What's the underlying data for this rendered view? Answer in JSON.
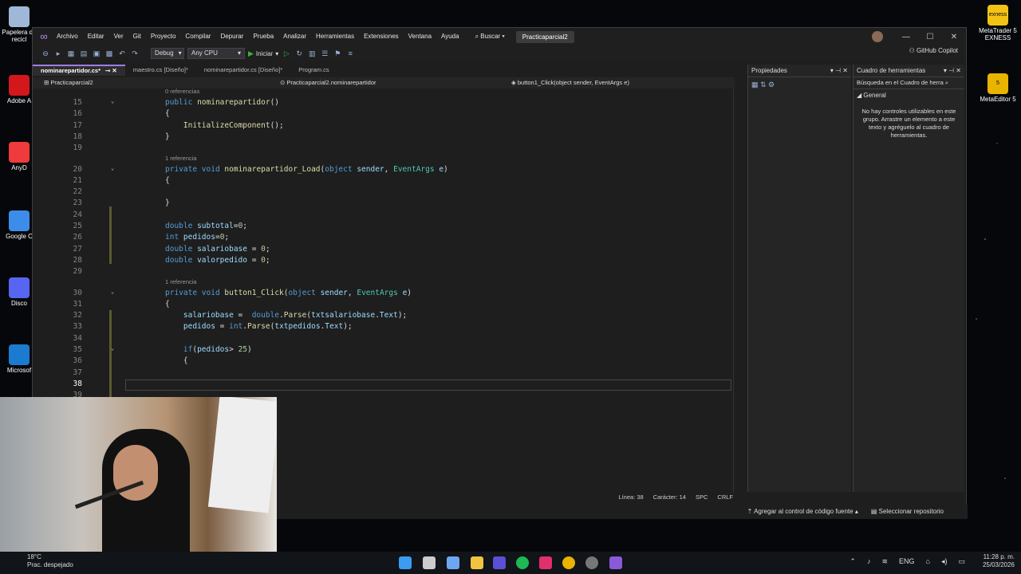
{
  "desktop_icons": [
    {
      "label": "Papelera de\nrecicl",
      "color": "#9fb8d8"
    },
    {
      "label": "Adobe A",
      "color": "#d4171d"
    },
    {
      "label": "AnyD",
      "color": "#ef3b3b"
    },
    {
      "label": "Google C",
      "color": "#3c8de9"
    },
    {
      "label": "Disco",
      "color": "#5865f2"
    },
    {
      "label": "Microsof",
      "color": "#1b7bd1"
    }
  ],
  "right_desktop_icons": [
    {
      "label": "MetaTrader 5\nEXNESS",
      "color": "#f2c315",
      "glyph": "exness"
    },
    {
      "label": "MetaEditor 5",
      "color": "#e9b400",
      "glyph": "5"
    }
  ],
  "menu": [
    "Archivo",
    "Editar",
    "Ver",
    "Git",
    "Proyecto",
    "Compilar",
    "Depurar",
    "Prueba",
    "Analizar",
    "Herramientas",
    "Extensiones",
    "Ventana",
    "Ayuda"
  ],
  "search_label": "Buscar",
  "project_name": "Practicaparcial2",
  "toolbar": {
    "config": "Debug",
    "platform": "Any CPU",
    "run": "Iniciar",
    "copilot": "GitHub Copilot"
  },
  "tabs": [
    {
      "label": "nominarepartidor.cs*",
      "active": true
    },
    {
      "label": "maestro.cs [Diseño]*"
    },
    {
      "label": "nominarepartidor.cs [Diseño]*"
    },
    {
      "label": "Program.cs"
    }
  ],
  "navbar": {
    "project": "Practicaparcial2",
    "class": "Practicaparcial2.nominarepartidor",
    "member": "button1_Click(object sender, EventArgs e)"
  },
  "code_lines": [
    {
      "n": 15,
      "lens": "0 referencias",
      "html": "<span class=\"kw\">public</span> <span class=\"fn\">nominarepartidor</span>()"
    },
    {
      "n": 16,
      "html": "{"
    },
    {
      "n": 17,
      "html": "    <span class=\"fn\">InitializeComponent</span>();"
    },
    {
      "n": 18,
      "html": "}"
    },
    {
      "n": 19,
      "html": ""
    },
    {
      "n": 20,
      "lens": "1 referencia",
      "html": "<span class=\"kw\">private</span> <span class=\"kw\">void</span> <span class=\"fn\">nominarepartidor_Load</span>(<span class=\"kw\">object</span> <span class=\"id\">sender</span>, <span class=\"ty\">EventArgs</span> <span class=\"id\">e</span>)"
    },
    {
      "n": 21,
      "html": "{"
    },
    {
      "n": 22,
      "html": ""
    },
    {
      "n": 23,
      "html": "}"
    },
    {
      "n": 24,
      "html": ""
    },
    {
      "n": 25,
      "html": "<span class=\"kw\">double</span> <span class=\"id\">subtotal</span>=<span class=\"nm\">0</span>;"
    },
    {
      "n": 26,
      "html": "<span class=\"kw\">int</span> <span class=\"id\">pedidos</span>=<span class=\"nm\">0</span>;"
    },
    {
      "n": 27,
      "html": "<span class=\"kw\">double</span> <span class=\"id\">salariobase</span> = <span class=\"nm\">0</span>;"
    },
    {
      "n": 28,
      "html": "<span class=\"kw\">double</span> <span class=\"id\">valorpedido</span> = <span class=\"nm\">0</span>;"
    },
    {
      "n": 29,
      "html": ""
    },
    {
      "n": 30,
      "lens": "1 referencia",
      "html": "<span class=\"kw\">private</span> <span class=\"kw\">void</span> <span class=\"fn\">button1_Click</span>(<span class=\"kw\">object</span> <span class=\"id\">sender</span>, <span class=\"ty\">EventArgs</span> <span class=\"id\">e</span>)"
    },
    {
      "n": 31,
      "html": "{"
    },
    {
      "n": 32,
      "html": "    <span class=\"id\">salariobase</span> =  <span class=\"kw\">double</span>.<span class=\"fn\">Parse</span>(<span class=\"id\">txtsalariobase</span>.<span class=\"id\">Text</span>);"
    },
    {
      "n": 33,
      "html": "    <span class=\"id\">pedidos</span> = <span class=\"kw\">int</span>.<span class=\"fn\">Parse</span>(<span class=\"id\">txtpedidos</span>.<span class=\"id\">Text</span>);"
    },
    {
      "n": 34,
      "html": ""
    },
    {
      "n": 35,
      "html": "    <span class=\"kw\">if</span>(<span class=\"id\">pedidos</span>&gt; <span class=\"nm\">25</span>)"
    },
    {
      "n": 36,
      "html": "    {"
    },
    {
      "n": 37,
      "html": ""
    },
    {
      "n": 38,
      "html": ""
    },
    {
      "n": 39,
      "html": ""
    }
  ],
  "status": {
    "line": "Línea: 38",
    "char": "Carácter: 14",
    "spc": "SPC",
    "crlf": "CRLF"
  },
  "bottom": {
    "source": "Agregar al control de código fuente",
    "repo": "Seleccionar repositorio"
  },
  "properties_title": "Propiedades",
  "toolbox": {
    "title": "Cuadro de herramientas",
    "search": "Búsqueda en el Cuadro de herra",
    "group": "General",
    "message": "No hay controles utilizables en este grupo. Arrastre un elemento a este texto y agréguelo al cuadro de herramientas."
  },
  "weather": {
    "temp": "18°C",
    "desc": "Prac. despejado"
  },
  "clock": {
    "time": "11:28 p. m.",
    "date": "25/03/2026"
  },
  "lang": "ENG"
}
